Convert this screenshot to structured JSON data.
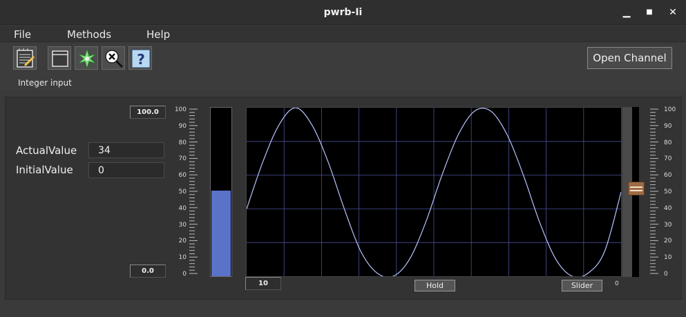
{
  "window": {
    "title": "pwrb-Ii",
    "minimize_glyph": "▁",
    "maximize_glyph": "■",
    "close_glyph": "✕"
  },
  "menu": {
    "items": [
      "File",
      "Methods",
      "Help"
    ]
  },
  "toolbar": {
    "buttons": [
      "notepad-icon",
      "window-icon",
      "star-burst-icon",
      "zoom-reset-icon",
      "help-icon"
    ],
    "open_channel_label": "Open Channel",
    "status_text": "Integer input"
  },
  "fields": {
    "actual_label": "ActualValue",
    "actual_value": "34",
    "initial_label": "InitialValue",
    "initial_value": "0"
  },
  "bar": {
    "max_label": "100.0",
    "min_label": "0.0",
    "level": 0.51,
    "color": "#5a72c8"
  },
  "scale": {
    "ticks": [
      "100",
      "90",
      "80",
      "70",
      "60",
      "50",
      "40",
      "30",
      "20",
      "10",
      "0"
    ]
  },
  "trend": {
    "time_range": "10",
    "hold_label": "Hold",
    "slider_label": "Slider",
    "slider_min_label": "0",
    "line_color": "#b9c4ff",
    "grid_color": "#4a4f9a"
  },
  "slider": {
    "level": 0.52
  },
  "chart_data": {
    "type": "line",
    "ylim": [
      0,
      100
    ],
    "series": [
      {
        "values": [
          40,
          68,
          90,
          100,
          90,
          68,
          40,
          15,
          2,
          0,
          10,
          32,
          60,
          84,
          98,
          98,
          84,
          60,
          32,
          10,
          0,
          2,
          15,
          50
        ]
      }
    ]
  }
}
